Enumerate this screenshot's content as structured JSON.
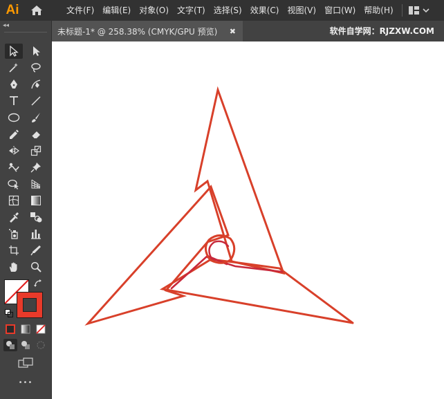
{
  "app": {
    "logo": "Ai"
  },
  "menu": [
    "文件(F)",
    "编辑(E)",
    "对象(O)",
    "文字(T)",
    "选择(S)",
    "效果(C)",
    "视图(V)",
    "窗口(W)",
    "帮助(H)"
  ],
  "document_tab": {
    "title": "未标题-1* @ 258.38% (CMYK/GPU 预览)",
    "close_glyph": "✖"
  },
  "watermark": "软件自学网：RJZXW.COM",
  "toolbar": {
    "collapse_glyph": "◂◂",
    "more_label": "•••"
  },
  "colors": {
    "fill": "none",
    "stroke": "#e83a2a",
    "artwork_stroke": "#d8402a",
    "menubar_bg": "#323232",
    "toolbar_bg": "#424242"
  }
}
